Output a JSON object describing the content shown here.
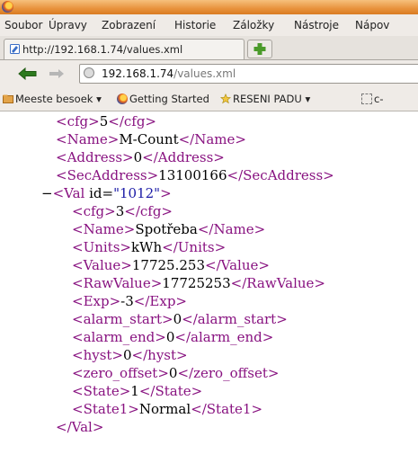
{
  "menu": {
    "items": [
      "Soubor",
      "Úpravy",
      "Zobrazení",
      "Historie",
      "Záložky",
      "Nástroje",
      "Nápov"
    ]
  },
  "tab": {
    "title": "http://192.168.1.74/values.xml"
  },
  "address": {
    "host": "192.168.1.74",
    "path": "/values.xml"
  },
  "bookmarks": {
    "items": [
      "Meeste besoek",
      "Getting Started",
      "RESENI PADU",
      "c-"
    ]
  },
  "xml": {
    "cfg_top": "5",
    "name_top": "M-Count",
    "address": "0",
    "secaddress": "13100166",
    "collapse_marker": "−",
    "val_id": "\"1012\"",
    "val": {
      "cfg": "3",
      "name": "Spotřeba",
      "units": "kWh",
      "value": "17725.253",
      "rawvalue": "17725253",
      "exp": "-3",
      "alarm_start": "0",
      "alarm_end": "0",
      "hyst": "0",
      "zero_offset": "0",
      "state": "1",
      "state1": "Normal"
    }
  },
  "colors": {
    "tag": "#881280",
    "attr_value": "#1a1aa6",
    "titlebar": "#e8923c"
  },
  "icons": [
    "firefox-logo-icon",
    "page-icon",
    "plus-icon",
    "back-arrow-icon",
    "forward-arrow-icon",
    "globe-icon",
    "folder-icon",
    "star-icon"
  ]
}
